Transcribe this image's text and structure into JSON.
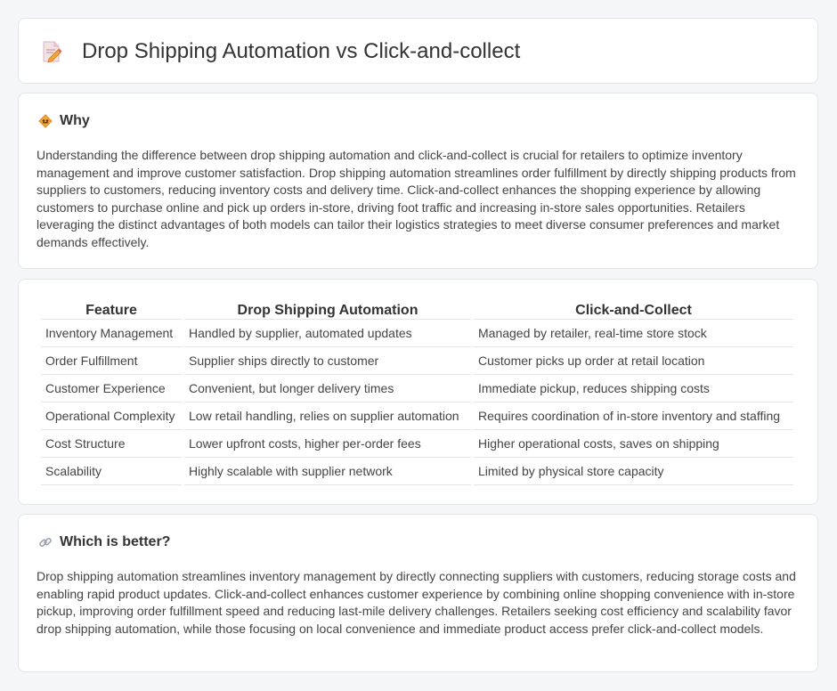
{
  "header": {
    "title": "Drop Shipping Automation vs Click-and-collect",
    "icon": "document-pencil-icon"
  },
  "why": {
    "icon": "diamond-sign-icon",
    "heading": "Why",
    "text": "Understanding the difference between drop shipping automation and click-and-collect is crucial for retailers to optimize inventory management and improve customer satisfaction. Drop shipping automation streamlines order fulfillment by directly shipping products from suppliers to customers, reducing inventory costs and delivery time. Click-and-collect enhances the shopping experience by allowing customers to purchase online and pick up orders in-store, driving foot traffic and increasing in-store sales opportunities. Retailers leveraging the distinct advantages of both models can tailor their logistics strategies to meet diverse consumer preferences and market demands effectively."
  },
  "comparison": {
    "headers": [
      "Feature",
      "Drop Shipping Automation",
      "Click-and-Collect"
    ],
    "rows": [
      [
        "Inventory Management",
        "Handled by supplier, automated updates",
        "Managed by retailer, real-time store stock"
      ],
      [
        "Order Fulfillment",
        "Supplier ships directly to customer",
        "Customer picks up order at retail location"
      ],
      [
        "Customer Experience",
        "Convenient, but longer delivery times",
        "Immediate pickup, reduces shipping costs"
      ],
      [
        "Operational Complexity",
        "Low retail handling, relies on supplier automation",
        "Requires coordination of in-store inventory and staffing"
      ],
      [
        "Cost Structure",
        "Lower upfront costs, higher per-order fees",
        "Higher operational costs, saves on shipping"
      ],
      [
        "Scalability",
        "Highly scalable with supplier network",
        "Limited by physical store capacity"
      ]
    ]
  },
  "better": {
    "icon": "link-icon",
    "heading": "Which is better?",
    "text": "Drop shipping automation streamlines inventory management by directly connecting suppliers with customers, reducing storage costs and enabling rapid product updates. Click-and-collect enhances customer experience by combining online shopping convenience with in-store pickup, improving order fulfillment speed and reducing last-mile delivery challenges. Retailers seeking cost efficiency and scalability favor drop shipping automation, while those focusing on local convenience and immediate product access prefer click-and-collect models."
  }
}
